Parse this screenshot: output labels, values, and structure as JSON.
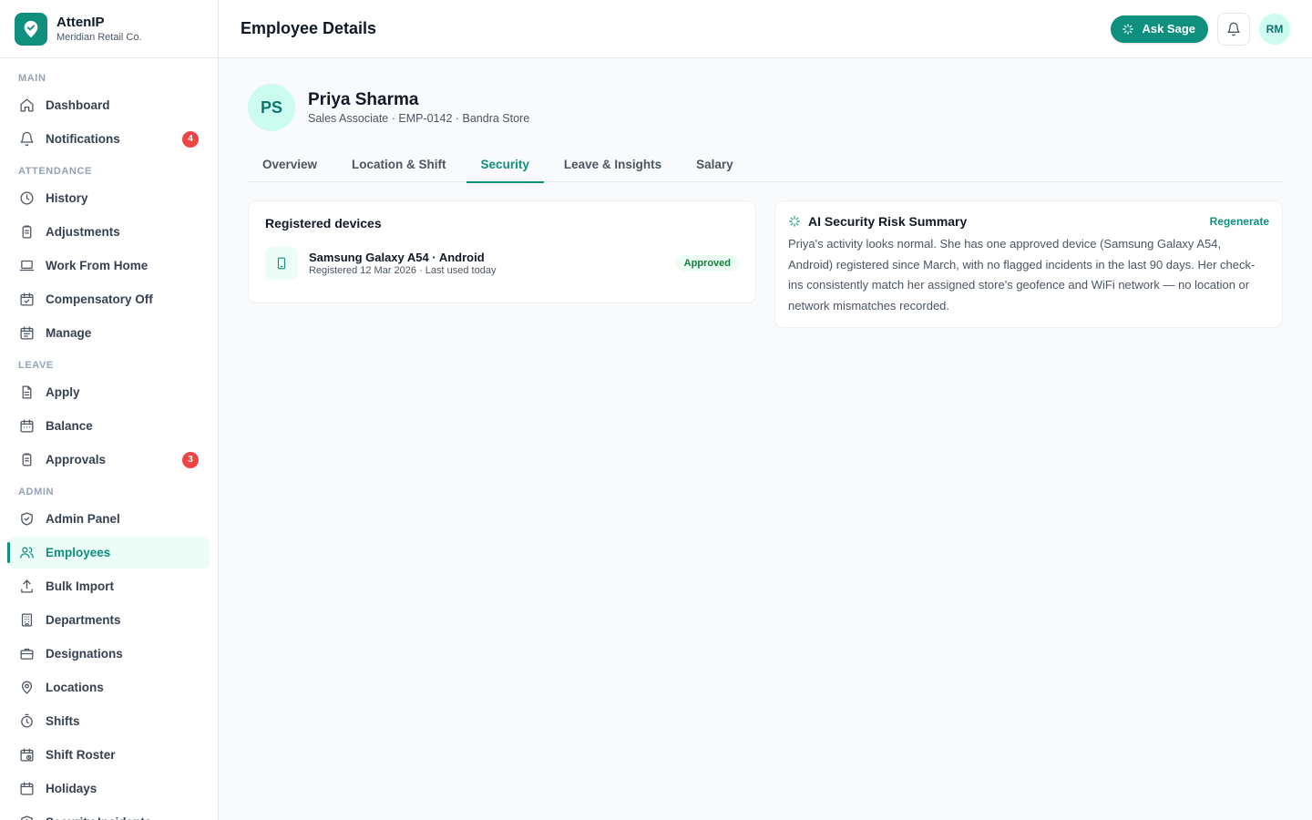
{
  "brand": {
    "name": "AttenIP",
    "org": "Meridian Retail Co."
  },
  "sidebar": {
    "sections": [
      {
        "label": "MAIN",
        "items": [
          {
            "label": "Dashboard",
            "icon": "home-icon"
          },
          {
            "label": "Notifications",
            "icon": "bell-icon",
            "badge": "4"
          }
        ]
      },
      {
        "label": "ATTENDANCE",
        "items": [
          {
            "label": "History",
            "icon": "clock-icon"
          },
          {
            "label": "Adjustments",
            "icon": "clipboard-icon"
          },
          {
            "label": "Work From Home",
            "icon": "laptop-icon"
          },
          {
            "label": "Compensatory Off",
            "icon": "calendar-check-icon"
          },
          {
            "label": "Manage",
            "icon": "calendar-grid-icon"
          }
        ]
      },
      {
        "label": "LEAVE",
        "items": [
          {
            "label": "Apply",
            "icon": "file-icon"
          },
          {
            "label": "Balance",
            "icon": "calendar-dots-icon"
          },
          {
            "label": "Approvals",
            "icon": "clipboard-icon",
            "badge": "3"
          }
        ]
      },
      {
        "label": "ADMIN",
        "items": [
          {
            "label": "Admin Panel",
            "icon": "shield-check-icon"
          },
          {
            "label": "Employees",
            "icon": "users-icon",
            "active": true
          },
          {
            "label": "Bulk Import",
            "icon": "upload-icon"
          },
          {
            "label": "Departments",
            "icon": "building-icon"
          },
          {
            "label": "Designations",
            "icon": "briefcase-icon"
          },
          {
            "label": "Locations",
            "icon": "map-pin-icon"
          },
          {
            "label": "Shifts",
            "icon": "timer-icon"
          },
          {
            "label": "Shift Roster",
            "icon": "calendar-clock-icon"
          },
          {
            "label": "Holidays",
            "icon": "calendar-icon"
          },
          {
            "label": "Security Incidents",
            "icon": "shield-alert-icon"
          }
        ]
      }
    ]
  },
  "header": {
    "title": "Employee Details",
    "ask_label": "Ask Sage",
    "user_initials": "RM"
  },
  "employee": {
    "initials": "PS",
    "name": "Priya Sharma",
    "meta": "Sales Associate · EMP-0142 · Bandra Store"
  },
  "tabs": [
    {
      "label": "Overview"
    },
    {
      "label": "Location & Shift"
    },
    {
      "label": "Security",
      "active": true
    },
    {
      "label": "Leave & Insights"
    },
    {
      "label": "Salary"
    }
  ],
  "devices": {
    "title": "Registered devices",
    "items": [
      {
        "name": "Samsung Galaxy A54 · Android",
        "sub": "Registered 12 Mar 2026 · Last used today",
        "status": "Approved"
      }
    ]
  },
  "ai_summary": {
    "title": "AI Security Risk Summary",
    "action": "Regenerate",
    "body": "Priya's activity looks normal. She has one approved device (Samsung Galaxy A54, Android) registered since March, with no flagged incidents in the last 90 days. Her check-ins consistently match her assigned store's geofence and WiFi network — no location or network mismatches recorded."
  },
  "colors": {
    "accent": "#0f8f7e",
    "badge": "#ef4444",
    "approved": "#15803d"
  }
}
